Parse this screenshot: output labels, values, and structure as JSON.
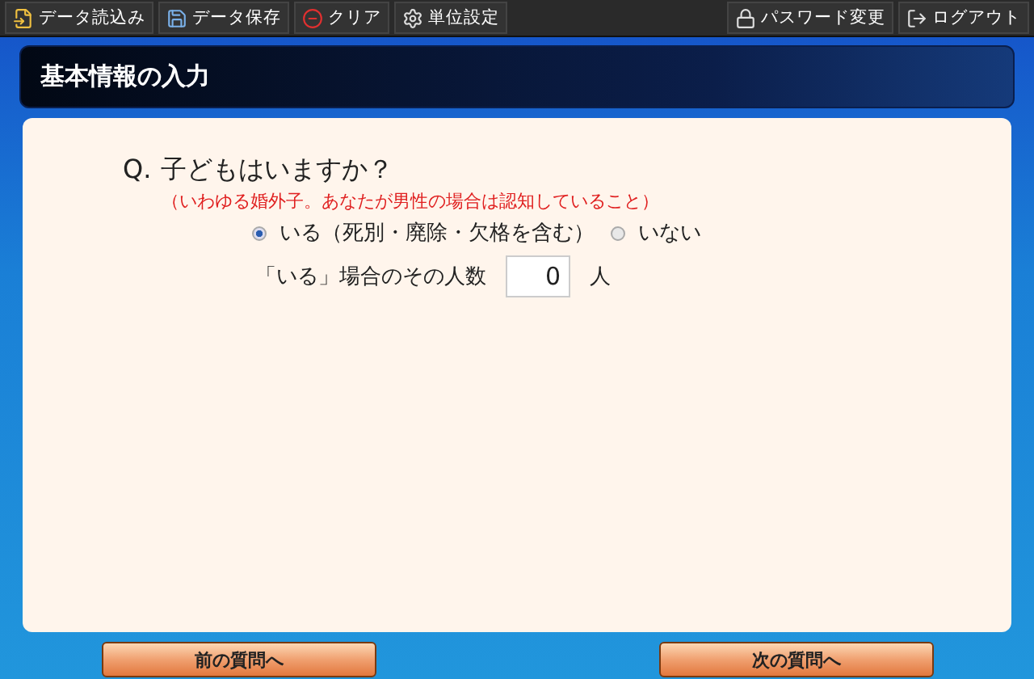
{
  "toolbar": {
    "left": [
      {
        "kind": "load",
        "label": "データ読込み"
      },
      {
        "kind": "save",
        "label": "データ保存"
      },
      {
        "kind": "clear",
        "label": "クリア"
      },
      {
        "kind": "settings",
        "label": "単位設定"
      }
    ],
    "right": [
      {
        "kind": "password",
        "label": "パスワード変更"
      },
      {
        "kind": "logout",
        "label": "ログアウト"
      }
    ]
  },
  "header": {
    "title": "基本情報の入力"
  },
  "question": {
    "prefix": "Q.",
    "text": "子どもはいますか？",
    "note": "（いわゆる婚外子。あなたが男性の場合は認知していること）",
    "options": [
      {
        "label": "いる（死別・廃除・欠格を含む）",
        "selected": true
      },
      {
        "label": "いない",
        "selected": false
      }
    ],
    "count": {
      "label": "「いる」場合のその人数",
      "value": "0",
      "unit": "人"
    }
  },
  "nav": [
    {
      "label": "前の質問へ"
    },
    {
      "label": "次の質問へ"
    }
  ]
}
